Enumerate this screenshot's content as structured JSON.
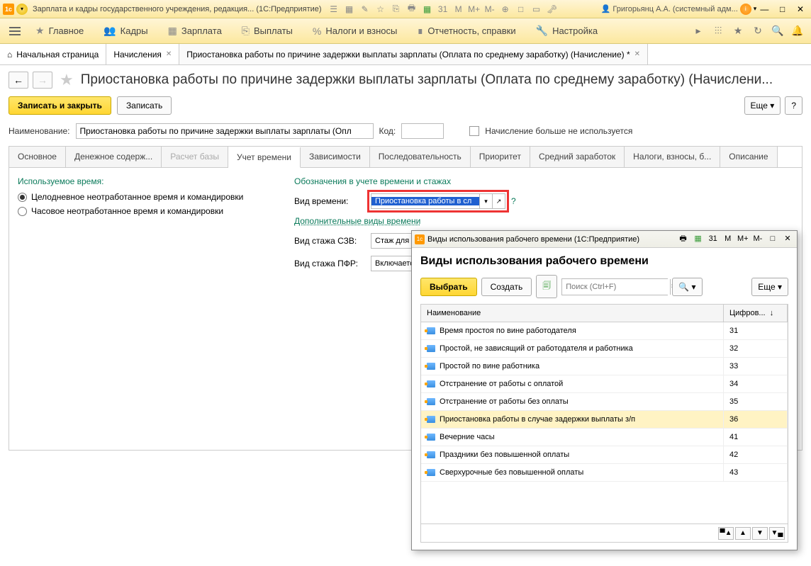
{
  "titlebar": {
    "app_title": "Зарплата и кадры государственного учреждения, редакция...  (1С:Предприятие)",
    "user": "Григорьянц А.А. (системный адм...",
    "m_labels": [
      "M",
      "M+",
      "M-"
    ]
  },
  "menu": {
    "items": [
      {
        "icon": "★",
        "label": "Главное"
      },
      {
        "icon": "👥",
        "label": "Кадры"
      },
      {
        "icon": "▦",
        "label": "Зарплата"
      },
      {
        "icon": "⎘",
        "label": "Выплаты"
      },
      {
        "icon": "%",
        "label": "Налоги и взносы"
      },
      {
        "icon": "∎",
        "label": "Отчетность, справки"
      },
      {
        "icon": "🔧",
        "label": "Настройка"
      }
    ]
  },
  "tabs": {
    "items": [
      {
        "icon": "⌂",
        "label": "Начальная страница",
        "closable": false
      },
      {
        "icon": "",
        "label": "Начисления",
        "closable": true
      },
      {
        "icon": "",
        "label": "Приостановка работы по причине задержки выплаты зарплаты (Оплата по среднему заработку) (Начисление) *",
        "closable": true
      }
    ]
  },
  "page": {
    "title": "Приостановка работы по причине задержки выплаты зарплаты (Оплата по среднему заработку) (Начислени...",
    "btn_save_close": "Записать и закрыть",
    "btn_save": "Записать",
    "btn_more": "Еще",
    "btn_help": "?",
    "name_label": "Наименование:",
    "name_value": "Приостановка работы по причине задержки выплаты зарплаты (Опл",
    "code_label": "Код:",
    "code_value": "",
    "unused_label": "Начисление больше не используется"
  },
  "inner_tabs": [
    "Основное",
    "Денежное содерж...",
    "Расчет базы",
    "Учет времени",
    "Зависимости",
    "Последовательность",
    "Приоритет",
    "Средний заработок",
    "Налоги, взносы, б...",
    "Описание"
  ],
  "time_panel": {
    "used_time_title": "Используемое время:",
    "radio1": "Целодневное неотработанное время и командировки",
    "radio2": "Часовое неотработанное время и командировки",
    "designations_title": "Обозначения в учете времени и стажах",
    "time_type_label": "Вид времени:",
    "time_type_value": "Приостановка работы в сл",
    "additional_title": "Дополнительные виды времени",
    "szv_label": "Вид стажа СЗВ:",
    "szv_value": "Стаж для до",
    "pfr_label": "Вид стажа ПФР:",
    "pfr_value": "Включается"
  },
  "popup": {
    "window_title": "Виды использования рабочего времени  (1С:Предприятие)",
    "title": "Виды использования рабочего времени",
    "btn_select": "Выбрать",
    "btn_create": "Создать",
    "search_placeholder": "Поиск (Ctrl+F)",
    "btn_more": "Еще",
    "col_name": "Наименование",
    "col_code": "Цифров...",
    "sort_indicator": "↓",
    "rows": [
      {
        "name": "Время простоя по вине работодателя",
        "code": "31"
      },
      {
        "name": "Простой, не зависящий от работодателя и работника",
        "code": "32"
      },
      {
        "name": "Простой по вине работника",
        "code": "33"
      },
      {
        "name": "Отстранение от работы с оплатой",
        "code": "34"
      },
      {
        "name": "Отстранение от работы без оплаты",
        "code": "35"
      },
      {
        "name": "Приостановка работы в случае задержки выплаты з/п",
        "code": "36",
        "selected": true
      },
      {
        "name": "Вечерние часы",
        "code": "41"
      },
      {
        "name": "Праздники без повышенной оплаты",
        "code": "42"
      },
      {
        "name": "Сверхурочные без повышенной оплаты",
        "code": "43"
      }
    ]
  }
}
